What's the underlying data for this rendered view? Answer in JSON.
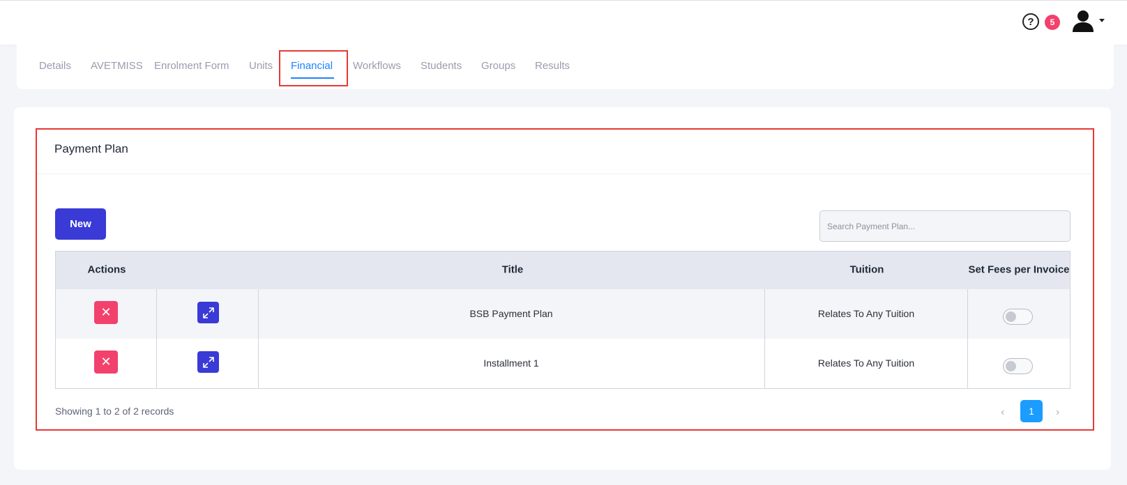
{
  "header": {
    "help_icon": "question-circle-icon",
    "help_label": "?",
    "notification_count": "5",
    "avatar_icon": "user-avatar-icon"
  },
  "tabs": [
    {
      "label": "Details"
    },
    {
      "label": "AVETMISS"
    },
    {
      "label": "Enrolment Form"
    },
    {
      "label": "Units"
    },
    {
      "label": "Financial",
      "active": true
    },
    {
      "label": "Workflows"
    },
    {
      "label": "Students"
    },
    {
      "label": "Groups"
    },
    {
      "label": "Results"
    }
  ],
  "panel": {
    "title": "Payment Plan",
    "new_button": "New",
    "search_placeholder": "Search Payment Plan..."
  },
  "table": {
    "headers": [
      "Actions",
      "Title",
      "Tuition",
      "Set Fees per Invoice"
    ],
    "rows": [
      {
        "title": "BSB Payment Plan",
        "tuition": "Relates To Any Tuition",
        "set_fees": false
      },
      {
        "title": "Installment 1",
        "tuition": "Relates To Any Tuition",
        "set_fees": false
      }
    ]
  },
  "pagination": {
    "info": "Showing 1 to 2 of 2 records",
    "prev": "‹",
    "current": "1",
    "next": "›"
  },
  "colors": {
    "primary": "#3a3ad6",
    "danger": "#f1416c",
    "active_tab": "#1b84ff",
    "highlight": "#e53935"
  }
}
